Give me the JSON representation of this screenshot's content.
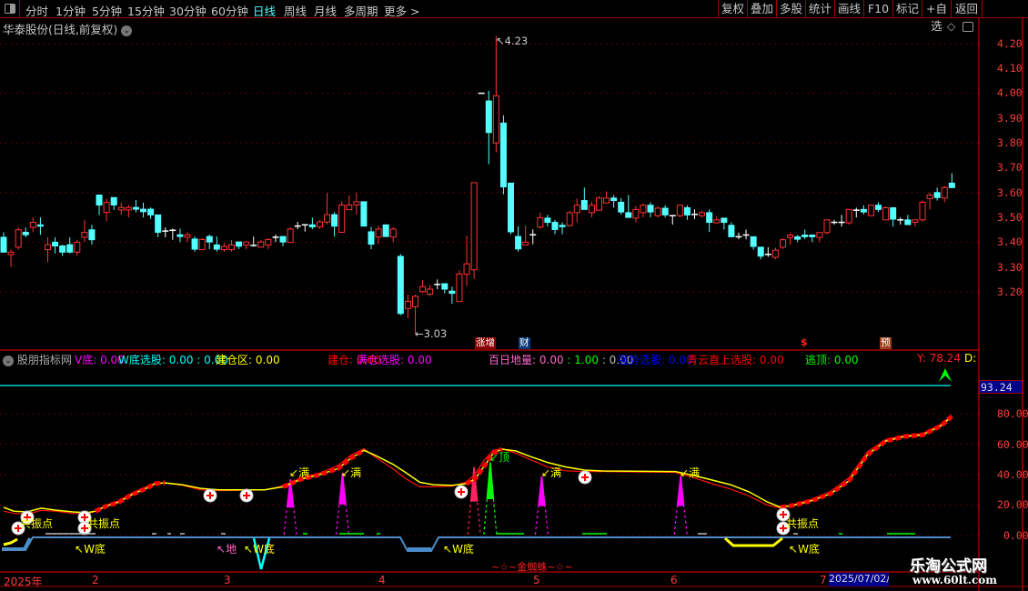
{
  "toolbar": {
    "periods": [
      "分时",
      "1分钟",
      "5分钟",
      "15分钟",
      "30分钟",
      "60分钟",
      "日线",
      "周线",
      "月线",
      "多周期",
      "更多 >"
    ],
    "active_period": "日线",
    "buttons": [
      "复权",
      "叠加",
      "多股",
      "统计",
      "画线",
      "F10",
      "标记",
      "+自选",
      "返回"
    ]
  },
  "chart_title": "华泰股份(日线,前复权)",
  "price_axis": [
    "4.20",
    "4.10",
    "4.00",
    "3.90",
    "3.80",
    "3.70",
    "3.60",
    "3.50",
    "3.40",
    "3.30",
    "3.20"
  ],
  "price_annotations": {
    "high": "4.23",
    "low": "3.03"
  },
  "event_badges": [
    {
      "text": "涨增",
      "bg": "#8b0000"
    },
    {
      "text": "财",
      "bg": "#0a3a78"
    },
    {
      "text": "$",
      "bg": "transparent"
    },
    {
      "text": "预",
      "bg": "#a0401a"
    }
  ],
  "indicator": {
    "name": "股朋指标网",
    "items": [
      {
        "label": "V底:",
        "value": "0.00",
        "color": "#ff00ff"
      },
      {
        "label": "W底选股:",
        "value": "0.00 : 0.00",
        "color": "#00ffff"
      },
      {
        "label": "建仓区:",
        "value": "0.00",
        "color": "#ffff00"
      },
      {
        "label": "建仓:",
        "value": "0.00",
        "color": "#ff0000"
      },
      {
        "label": "满仓选股:",
        "value": "0.00",
        "color": "#ff00ff"
      },
      {
        "label": "百日地量:",
        "value": "0.00",
        "color": "#ff66cc"
      },
      {
        "label": "强势选股:",
        "value": "0.00",
        "color": "#0000ff"
      },
      {
        "label": "青云直上选股:",
        "value": "0.00",
        "color": "#ff0000"
      },
      {
        "label": "逃顶:",
        "value": "0.00",
        "color": "#00ff00"
      }
    ],
    "dil_extra1": ": 1.00",
    "dil_extra2": ": 0.00",
    "y_label": "Y: 78.24",
    "d_label": "D:",
    "axis": [
      "93.24",
      "80.00",
      "60.00",
      "40.00",
      "20.00",
      "0.00"
    ],
    "markers": {
      "man": "满",
      "top": "顶",
      "resonance": "共振点",
      "w_bottom": "W底",
      "di": "地",
      "banner": "~☆~金蜘蛛~☆~"
    }
  },
  "date_axis": [
    "2025年",
    "2",
    "3",
    "4",
    "5",
    "6",
    "7"
  ],
  "cursor_date": "2025/07/02/",
  "watermark": {
    "name": "乐淘公式网",
    "url": "www.60lt.com"
  },
  "colors": {
    "up": "#ff3232",
    "down": "#54ffff",
    "flat": "#ffffff",
    "grid": "#a00000",
    "accent": "#00ffff"
  },
  "chart_data": {
    "type": "candlestick",
    "ylim": [
      3.0,
      4.25
    ],
    "candles_ohlc": [
      [
        3.42,
        3.44,
        3.36,
        3.36
      ],
      [
        3.35,
        3.37,
        3.3,
        3.36
      ],
      [
        3.38,
        3.46,
        3.37,
        3.45
      ],
      [
        3.44,
        3.46,
        3.42,
        3.43
      ],
      [
        3.46,
        3.5,
        3.44,
        3.48
      ],
      [
        3.47,
        3.5,
        3.43,
        3.465
      ],
      [
        3.37,
        3.42,
        3.32,
        3.39
      ],
      [
        3.4,
        3.42,
        3.355,
        3.385
      ],
      [
        3.385,
        3.39,
        3.345,
        3.36
      ],
      [
        3.39,
        3.42,
        3.355,
        3.36
      ],
      [
        3.36,
        3.41,
        3.345,
        3.4
      ],
      [
        3.42,
        3.49,
        3.4,
        3.44
      ],
      [
        3.45,
        3.47,
        3.39,
        3.41
      ],
      [
        3.59,
        3.59,
        3.51,
        3.55
      ],
      [
        3.52,
        3.575,
        3.485,
        3.56
      ],
      [
        3.58,
        3.58,
        3.53,
        3.55
      ],
      [
        3.53,
        3.56,
        3.51,
        3.54
      ],
      [
        3.53,
        3.55,
        3.5,
        3.54
      ],
      [
        3.54,
        3.57,
        3.52,
        3.533
      ],
      [
        3.533,
        3.56,
        3.5,
        3.523
      ],
      [
        3.533,
        3.54,
        3.494,
        3.51
      ],
      [
        3.51,
        3.51,
        3.42,
        3.44
      ],
      [
        3.445,
        3.46,
        3.42,
        3.445
      ],
      [
        3.448,
        3.455,
        3.41,
        3.448
      ],
      [
        3.43,
        3.455,
        3.4,
        3.423
      ],
      [
        3.42,
        3.44,
        3.4,
        3.43
      ],
      [
        3.413,
        3.423,
        3.362,
        3.372
      ],
      [
        3.37,
        3.418,
        3.37,
        3.411
      ],
      [
        3.423,
        3.431,
        3.372,
        3.401
      ],
      [
        3.389,
        3.423,
        3.362,
        3.372
      ],
      [
        3.37,
        3.396,
        3.362,
        3.383
      ],
      [
        3.37,
        3.409,
        3.362,
        3.389
      ],
      [
        3.401,
        3.401,
        3.372,
        3.384
      ],
      [
        3.389,
        3.401,
        3.372,
        3.401
      ],
      [
        3.387,
        3.423,
        3.382,
        3.387
      ],
      [
        3.38,
        3.409,
        3.38,
        3.401
      ],
      [
        3.389,
        3.416,
        3.372,
        3.411
      ],
      [
        3.42,
        3.431,
        3.401,
        3.42
      ],
      [
        3.423,
        3.423,
        3.384,
        3.401
      ],
      [
        3.399,
        3.46,
        3.399,
        3.453
      ],
      [
        3.465,
        3.482,
        3.453,
        3.465
      ],
      [
        3.47,
        3.47,
        3.443,
        3.47
      ],
      [
        3.47,
        3.499,
        3.453,
        3.462
      ],
      [
        3.462,
        3.489,
        3.453,
        3.482
      ],
      [
        3.481,
        3.599,
        3.472,
        3.511
      ],
      [
        3.511,
        3.521,
        3.423,
        3.465
      ],
      [
        3.44,
        3.565,
        3.44,
        3.55
      ],
      [
        3.531,
        3.589,
        3.531,
        3.55
      ],
      [
        3.55,
        3.599,
        3.511,
        3.563
      ],
      [
        3.563,
        3.563,
        3.465,
        3.465
      ],
      [
        3.442,
        3.462,
        3.372,
        3.392
      ],
      [
        3.421,
        3.467,
        3.392,
        3.453
      ],
      [
        3.47,
        3.47,
        3.423,
        3.423
      ],
      [
        3.421,
        3.46,
        3.401,
        3.453
      ],
      [
        3.343,
        3.352,
        3.106,
        3.113
      ],
      [
        3.133,
        3.189,
        3.094,
        3.162
      ],
      [
        3.14,
        3.189,
        3.03,
        3.182
      ],
      [
        3.201,
        3.247,
        3.194,
        3.221
      ],
      [
        3.191,
        3.228,
        3.182,
        3.211
      ],
      [
        3.23,
        3.25,
        3.211,
        3.23
      ],
      [
        3.233,
        3.233,
        3.194,
        3.211
      ],
      [
        3.203,
        3.221,
        3.152,
        3.194
      ],
      [
        3.161,
        3.287,
        3.161,
        3.272
      ],
      [
        3.271,
        3.427,
        3.224,
        3.313
      ],
      [
        3.289,
        3.64,
        3.252,
        3.64
      ],
      [
        4.0,
        4.0,
        4.0,
        4.0
      ],
      [
        3.969,
        4.01,
        3.714,
        3.842
      ],
      [
        3.8,
        4.23,
        3.762,
        3.99
      ],
      [
        3.88,
        3.911,
        3.593,
        3.623
      ],
      [
        3.638,
        3.638,
        3.432,
        3.442
      ],
      [
        3.423,
        3.464,
        3.362,
        3.373
      ],
      [
        3.389,
        3.466,
        3.389,
        3.4
      ],
      [
        3.43,
        3.452,
        3.392,
        3.43
      ],
      [
        3.461,
        3.519,
        3.454,
        3.499
      ],
      [
        3.497,
        3.51,
        3.463,
        3.48
      ],
      [
        3.48,
        3.49,
        3.432,
        3.451
      ],
      [
        3.468,
        3.48,
        3.432,
        3.463
      ],
      [
        3.467,
        3.527,
        3.463,
        3.519
      ],
      [
        3.519,
        3.576,
        3.48,
        3.549
      ],
      [
        3.568,
        3.62,
        3.532,
        3.532
      ],
      [
        3.519,
        3.563,
        3.5,
        3.549
      ],
      [
        3.529,
        3.585,
        3.529,
        3.578
      ],
      [
        3.558,
        3.605,
        3.558,
        3.578
      ],
      [
        3.578,
        3.59,
        3.539,
        3.568
      ],
      [
        3.561,
        3.578,
        3.512,
        3.522
      ],
      [
        3.519,
        3.59,
        3.5,
        3.5
      ],
      [
        3.497,
        3.546,
        3.48,
        3.532
      ],
      [
        3.519,
        3.556,
        3.5,
        3.549
      ],
      [
        3.549,
        3.561,
        3.5,
        3.522
      ],
      [
        3.507,
        3.546,
        3.5,
        3.537
      ],
      [
        3.537,
        3.549,
        3.5,
        3.51
      ],
      [
        3.507,
        3.507,
        3.471,
        3.507
      ],
      [
        3.507,
        3.549,
        3.5,
        3.549
      ],
      [
        3.539,
        3.549,
        3.49,
        3.51
      ],
      [
        3.512,
        3.532,
        3.493,
        3.512
      ],
      [
        3.507,
        3.527,
        3.5,
        3.519
      ],
      [
        3.519,
        3.532,
        3.441,
        3.48
      ],
      [
        3.478,
        3.505,
        3.478,
        3.49
      ],
      [
        3.497,
        3.497,
        3.451,
        3.48
      ],
      [
        3.468,
        3.48,
        3.422,
        3.422
      ],
      [
        3.422,
        3.439,
        3.412,
        3.422
      ],
      [
        3.429,
        3.451,
        3.412,
        3.429
      ],
      [
        3.422,
        3.422,
        3.37,
        3.383
      ],
      [
        3.38,
        3.38,
        3.331,
        3.344
      ],
      [
        3.351,
        3.38,
        3.341,
        3.351
      ],
      [
        3.339,
        3.378,
        3.331,
        3.368
      ],
      [
        3.38,
        3.417,
        3.373,
        3.41
      ],
      [
        3.419,
        3.436,
        3.39,
        3.429
      ],
      [
        3.422,
        3.429,
        3.4,
        3.412
      ],
      [
        3.429,
        3.451,
        3.412,
        3.422
      ],
      [
        3.429,
        3.429,
        3.4,
        3.422
      ],
      [
        3.419,
        3.439,
        3.4,
        3.439
      ],
      [
        3.439,
        3.49,
        3.432,
        3.49
      ],
      [
        3.48,
        3.49,
        3.471,
        3.48
      ],
      [
        3.48,
        3.51,
        3.463,
        3.48
      ],
      [
        3.478,
        3.532,
        3.471,
        3.532
      ],
      [
        3.529,
        3.539,
        3.5,
        3.529
      ],
      [
        3.532,
        3.549,
        3.512,
        3.522
      ],
      [
        3.507,
        3.549,
        3.507,
        3.549
      ],
      [
        3.549,
        3.561,
        3.522,
        3.532
      ],
      [
        3.49,
        3.544,
        3.49,
        3.539
      ],
      [
        3.539,
        3.539,
        3.463,
        3.493
      ],
      [
        3.49,
        3.5,
        3.471,
        3.49
      ],
      [
        3.49,
        3.51,
        3.471,
        3.471
      ],
      [
        3.48,
        3.49,
        3.463,
        3.49
      ],
      [
        3.49,
        3.568,
        3.483,
        3.561
      ],
      [
        3.576,
        3.6,
        3.532,
        3.59
      ],
      [
        3.6,
        3.62,
        3.568,
        3.58
      ],
      [
        3.578,
        3.627,
        3.561,
        3.62
      ],
      [
        3.638,
        3.678,
        3.62,
        3.62
      ]
    ],
    "indicator_ylim": [
      0,
      93.24
    ],
    "indicator_ref_line": 93.24,
    "line_yellow": [
      [
        0,
        18.5
      ],
      [
        1.4,
        16
      ],
      [
        3.2,
        15.5
      ],
      [
        5.1,
        18
      ],
      [
        7,
        16.7
      ],
      [
        9.4,
        15.5
      ],
      [
        11.3,
        15
      ],
      [
        12.5,
        16
      ],
      [
        13.8,
        19
      ],
      [
        15.7,
        22
      ],
      [
        17.5,
        27
      ],
      [
        19.4,
        31
      ],
      [
        20.6,
        34
      ],
      [
        21.9,
        34.6
      ],
      [
        24.3,
        33.4
      ],
      [
        26.8,
        31
      ],
      [
        29.3,
        30
      ],
      [
        35.5,
        30
      ],
      [
        38,
        32
      ],
      [
        40.5,
        37
      ],
      [
        43,
        40
      ],
      [
        45.5,
        44
      ],
      [
        47.3,
        51
      ],
      [
        49,
        56
      ],
      [
        50.4,
        53
      ],
      [
        52.9,
        47
      ],
      [
        54.8,
        41
      ],
      [
        56.6,
        35
      ],
      [
        58.5,
        33.4
      ],
      [
        61,
        33
      ],
      [
        62.9,
        34
      ],
      [
        64.1,
        37
      ],
      [
        65.3,
        45
      ],
      [
        66.6,
        54
      ],
      [
        67.8,
        56.7
      ],
      [
        69.7,
        55.5
      ],
      [
        71.6,
        52
      ],
      [
        74,
        48
      ],
      [
        76.5,
        45
      ],
      [
        79,
        43
      ],
      [
        81.5,
        42.4
      ],
      [
        91.4,
        42
      ],
      [
        93.9,
        39.4
      ],
      [
        96.4,
        36.4
      ],
      [
        98.9,
        33.4
      ],
      [
        101.4,
        28.7
      ],
      [
        103.9,
        22
      ],
      [
        105.7,
        18.5
      ],
      [
        107.6,
        20
      ],
      [
        110,
        23
      ],
      [
        112.5,
        27.5
      ],
      [
        115,
        36
      ],
      [
        117.5,
        53
      ],
      [
        120,
        62
      ],
      [
        122.5,
        65
      ],
      [
        125,
        66
      ],
      [
        127.5,
        72
      ],
      [
        129,
        78.24
      ]
    ],
    "line_red": [
      [
        0,
        16
      ],
      [
        1.4,
        14.5
      ],
      [
        3.2,
        14
      ],
      [
        5.1,
        16.5
      ],
      [
        7,
        16
      ],
      [
        9.4,
        14.5
      ],
      [
        11.3,
        14
      ],
      [
        12.5,
        16
      ],
      [
        13.8,
        19.5
      ],
      [
        15.7,
        23
      ],
      [
        17.5,
        28
      ],
      [
        19.4,
        32
      ],
      [
        20.6,
        34.5
      ],
      [
        21.9,
        34.5
      ],
      [
        24.3,
        33
      ],
      [
        26.8,
        30
      ],
      [
        29.3,
        29.5
      ],
      [
        35.5,
        30
      ],
      [
        38,
        32.5
      ],
      [
        40.5,
        38
      ],
      [
        43,
        41
      ],
      [
        45.5,
        46
      ],
      [
        47.3,
        53
      ],
      [
        49,
        57
      ],
      [
        50.4,
        52
      ],
      [
        52.9,
        44
      ],
      [
        54.8,
        37
      ],
      [
        56.6,
        32
      ],
      [
        58.5,
        32
      ],
      [
        61,
        32.5
      ],
      [
        62.9,
        35
      ],
      [
        64.1,
        40
      ],
      [
        65.3,
        49
      ],
      [
        66.6,
        56
      ],
      [
        67.8,
        57
      ],
      [
        69.7,
        54
      ],
      [
        71.6,
        50
      ],
      [
        74,
        45
      ],
      [
        76.5,
        42.5
      ],
      [
        79,
        42
      ],
      [
        81.5,
        42
      ],
      [
        91.4,
        41.5
      ],
      [
        93.9,
        38
      ],
      [
        96.4,
        34
      ],
      [
        98.9,
        30.5
      ],
      [
        101.4,
        26
      ],
      [
        103.9,
        20
      ],
      [
        105.7,
        18
      ],
      [
        107.6,
        20.5
      ],
      [
        110,
        24
      ],
      [
        112.5,
        29
      ],
      [
        115,
        38
      ],
      [
        117.5,
        55
      ],
      [
        120,
        63
      ],
      [
        122.5,
        65.5
      ],
      [
        125,
        67
      ],
      [
        127.5,
        73
      ],
      [
        129,
        79
      ]
    ],
    "rising_segments": [
      [
        12.5,
        22
      ],
      [
        37,
        49
      ],
      [
        62.5,
        68
      ],
      [
        105.7,
        129
      ]
    ],
    "spikes": [
      {
        "index": 39,
        "peak": 37,
        "color": "#ff00ff"
      },
      {
        "index": 46.1,
        "peak": 41,
        "color": "#ff00ff"
      },
      {
        "index": 64,
        "peak": 45,
        "color": "#ff2060"
      },
      {
        "index": 66.2,
        "peak": 48,
        "color": "#00ff00"
      },
      {
        "index": 73.2,
        "peak": 39,
        "color": "#ff00ff"
      },
      {
        "index": 92.1,
        "peak": 39,
        "color": "#ff00ff"
      }
    ]
  }
}
